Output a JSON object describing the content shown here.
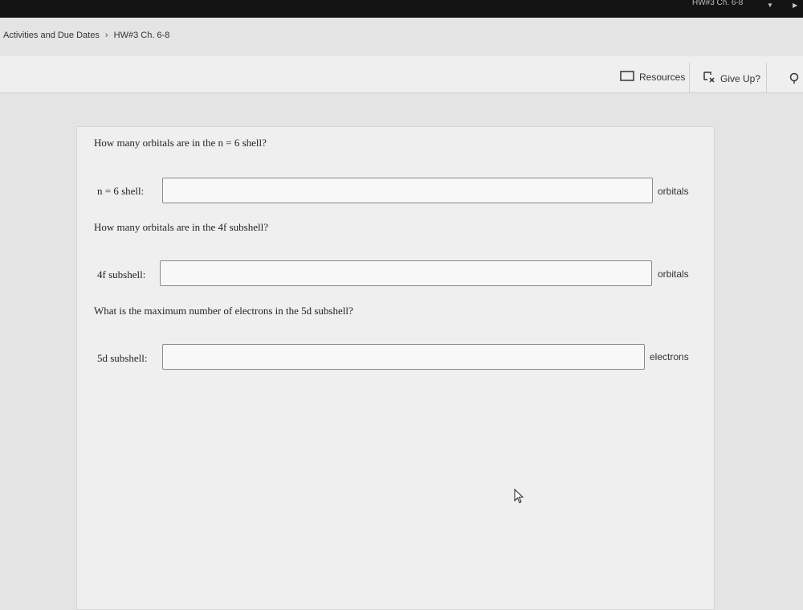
{
  "browser": {
    "tab_title": "HW#3 Ch. 6-8"
  },
  "breadcrumb": {
    "parent": "Activities and Due Dates",
    "current": "HW#3 Ch. 6-8"
  },
  "toolbar": {
    "resources_label": "Resources",
    "giveup_label": "Give Up?"
  },
  "questions": [
    {
      "prompt": "How many orbitals are in the n = 6 shell?",
      "field_label": "n = 6 shell:",
      "value": "",
      "unit": "orbitals"
    },
    {
      "prompt": "How many orbitals are in the 4f subshell?",
      "field_label": "4f subshell:",
      "value": "",
      "unit": "orbitals"
    },
    {
      "prompt": "What is the maximum number of electrons in the 5d subshell?",
      "field_label": "5d subshell:",
      "value": "",
      "unit": "electrons"
    }
  ]
}
